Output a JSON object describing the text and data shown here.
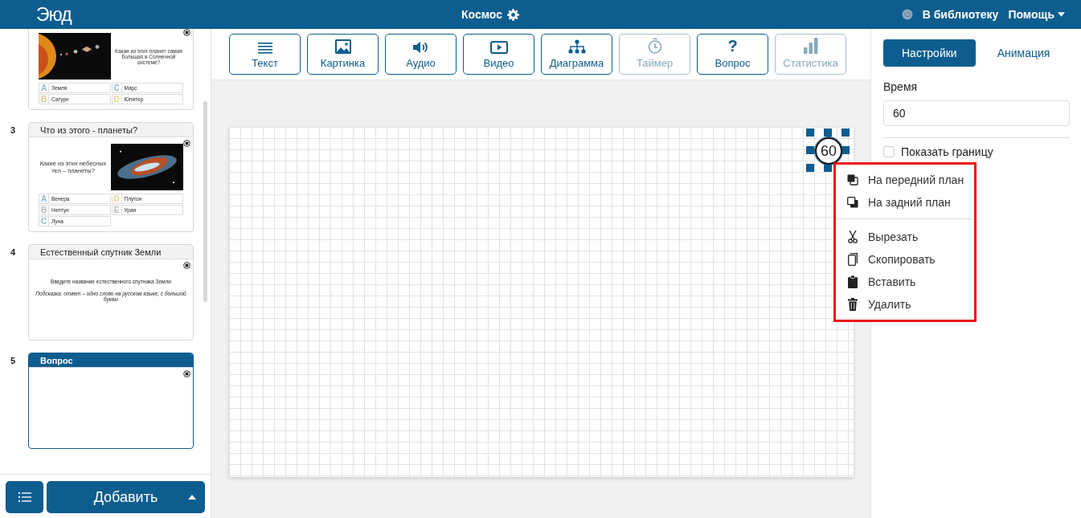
{
  "header": {
    "logo": "Эюд",
    "title": "Космос",
    "library_link": "В библиотеку",
    "help": "Помощь"
  },
  "slides": [
    {
      "kind": "quiz",
      "selected": false,
      "question": "Какая из этих планет самая большая в Солнечной системе?",
      "answers": [
        {
          "letter": "A",
          "text": "Земля",
          "color": "#8fb8cf"
        },
        {
          "letter": "B",
          "text": "Сатурн",
          "color": "#d9c98f"
        },
        {
          "letter": "C",
          "text": "Марс",
          "color": "#8fb8cf"
        },
        {
          "letter": "D",
          "text": "Юпитер",
          "color": "#e8d48a"
        }
      ]
    },
    {
      "kind": "quiz",
      "number": "3",
      "title": "Что из этого - планеты?",
      "selected": false,
      "question": "Какие из этих небесных тел – планеты?",
      "answers": [
        {
          "letter": "A",
          "text": "Венера",
          "color": "#8fb8cf"
        },
        {
          "letter": "B",
          "text": "Нептун",
          "color": "#b9b9b9"
        },
        {
          "letter": "C",
          "text": "Луна",
          "color": "#8fb8cf"
        },
        {
          "letter": "D",
          "text": "Плутон",
          "color": "#e8d48a"
        },
        {
          "letter": "E",
          "text": "Уран",
          "color": "#b9b9b9"
        }
      ]
    },
    {
      "kind": "input",
      "number": "4",
      "title": "Естественный спутник Земли",
      "selected": false,
      "question": "Введите название естественного спутника Земли",
      "hint": "Подсказка: ответ – одно слово на русском языке, с большой буквы"
    },
    {
      "kind": "blank",
      "number": "5",
      "title": "Вопрос",
      "selected": true
    }
  ],
  "add_button": "Добавить",
  "tools": [
    {
      "label": "Текст",
      "disabled": false
    },
    {
      "label": "Картинка",
      "disabled": false
    },
    {
      "label": "Аудио",
      "disabled": false
    },
    {
      "label": "Видео",
      "disabled": false
    },
    {
      "label": "Диаграмма",
      "disabled": false
    },
    {
      "label": "Таймер",
      "disabled": true
    },
    {
      "glyph": "?",
      "label": "Вопрос",
      "disabled": false
    },
    {
      "label": "Статистика",
      "disabled": true
    }
  ],
  "canvas": {
    "timer": "60"
  },
  "context_menu": {
    "groups": [
      [
        {
          "label": "На передний план"
        },
        {
          "label": "На задний план"
        }
      ],
      [
        {
          "label": "Вырезать"
        },
        {
          "label": "Скопировать"
        },
        {
          "label": "Вставить"
        },
        {
          "label": "Удалить"
        }
      ]
    ]
  },
  "panel": {
    "tabs": [
      {
        "label": "Настройки",
        "selected": true
      },
      {
        "label": "Анимация",
        "selected": false
      }
    ],
    "time_label": "Время",
    "time_value": "60",
    "show_border": {
      "label": "Показать границу",
      "checked": false
    }
  }
}
